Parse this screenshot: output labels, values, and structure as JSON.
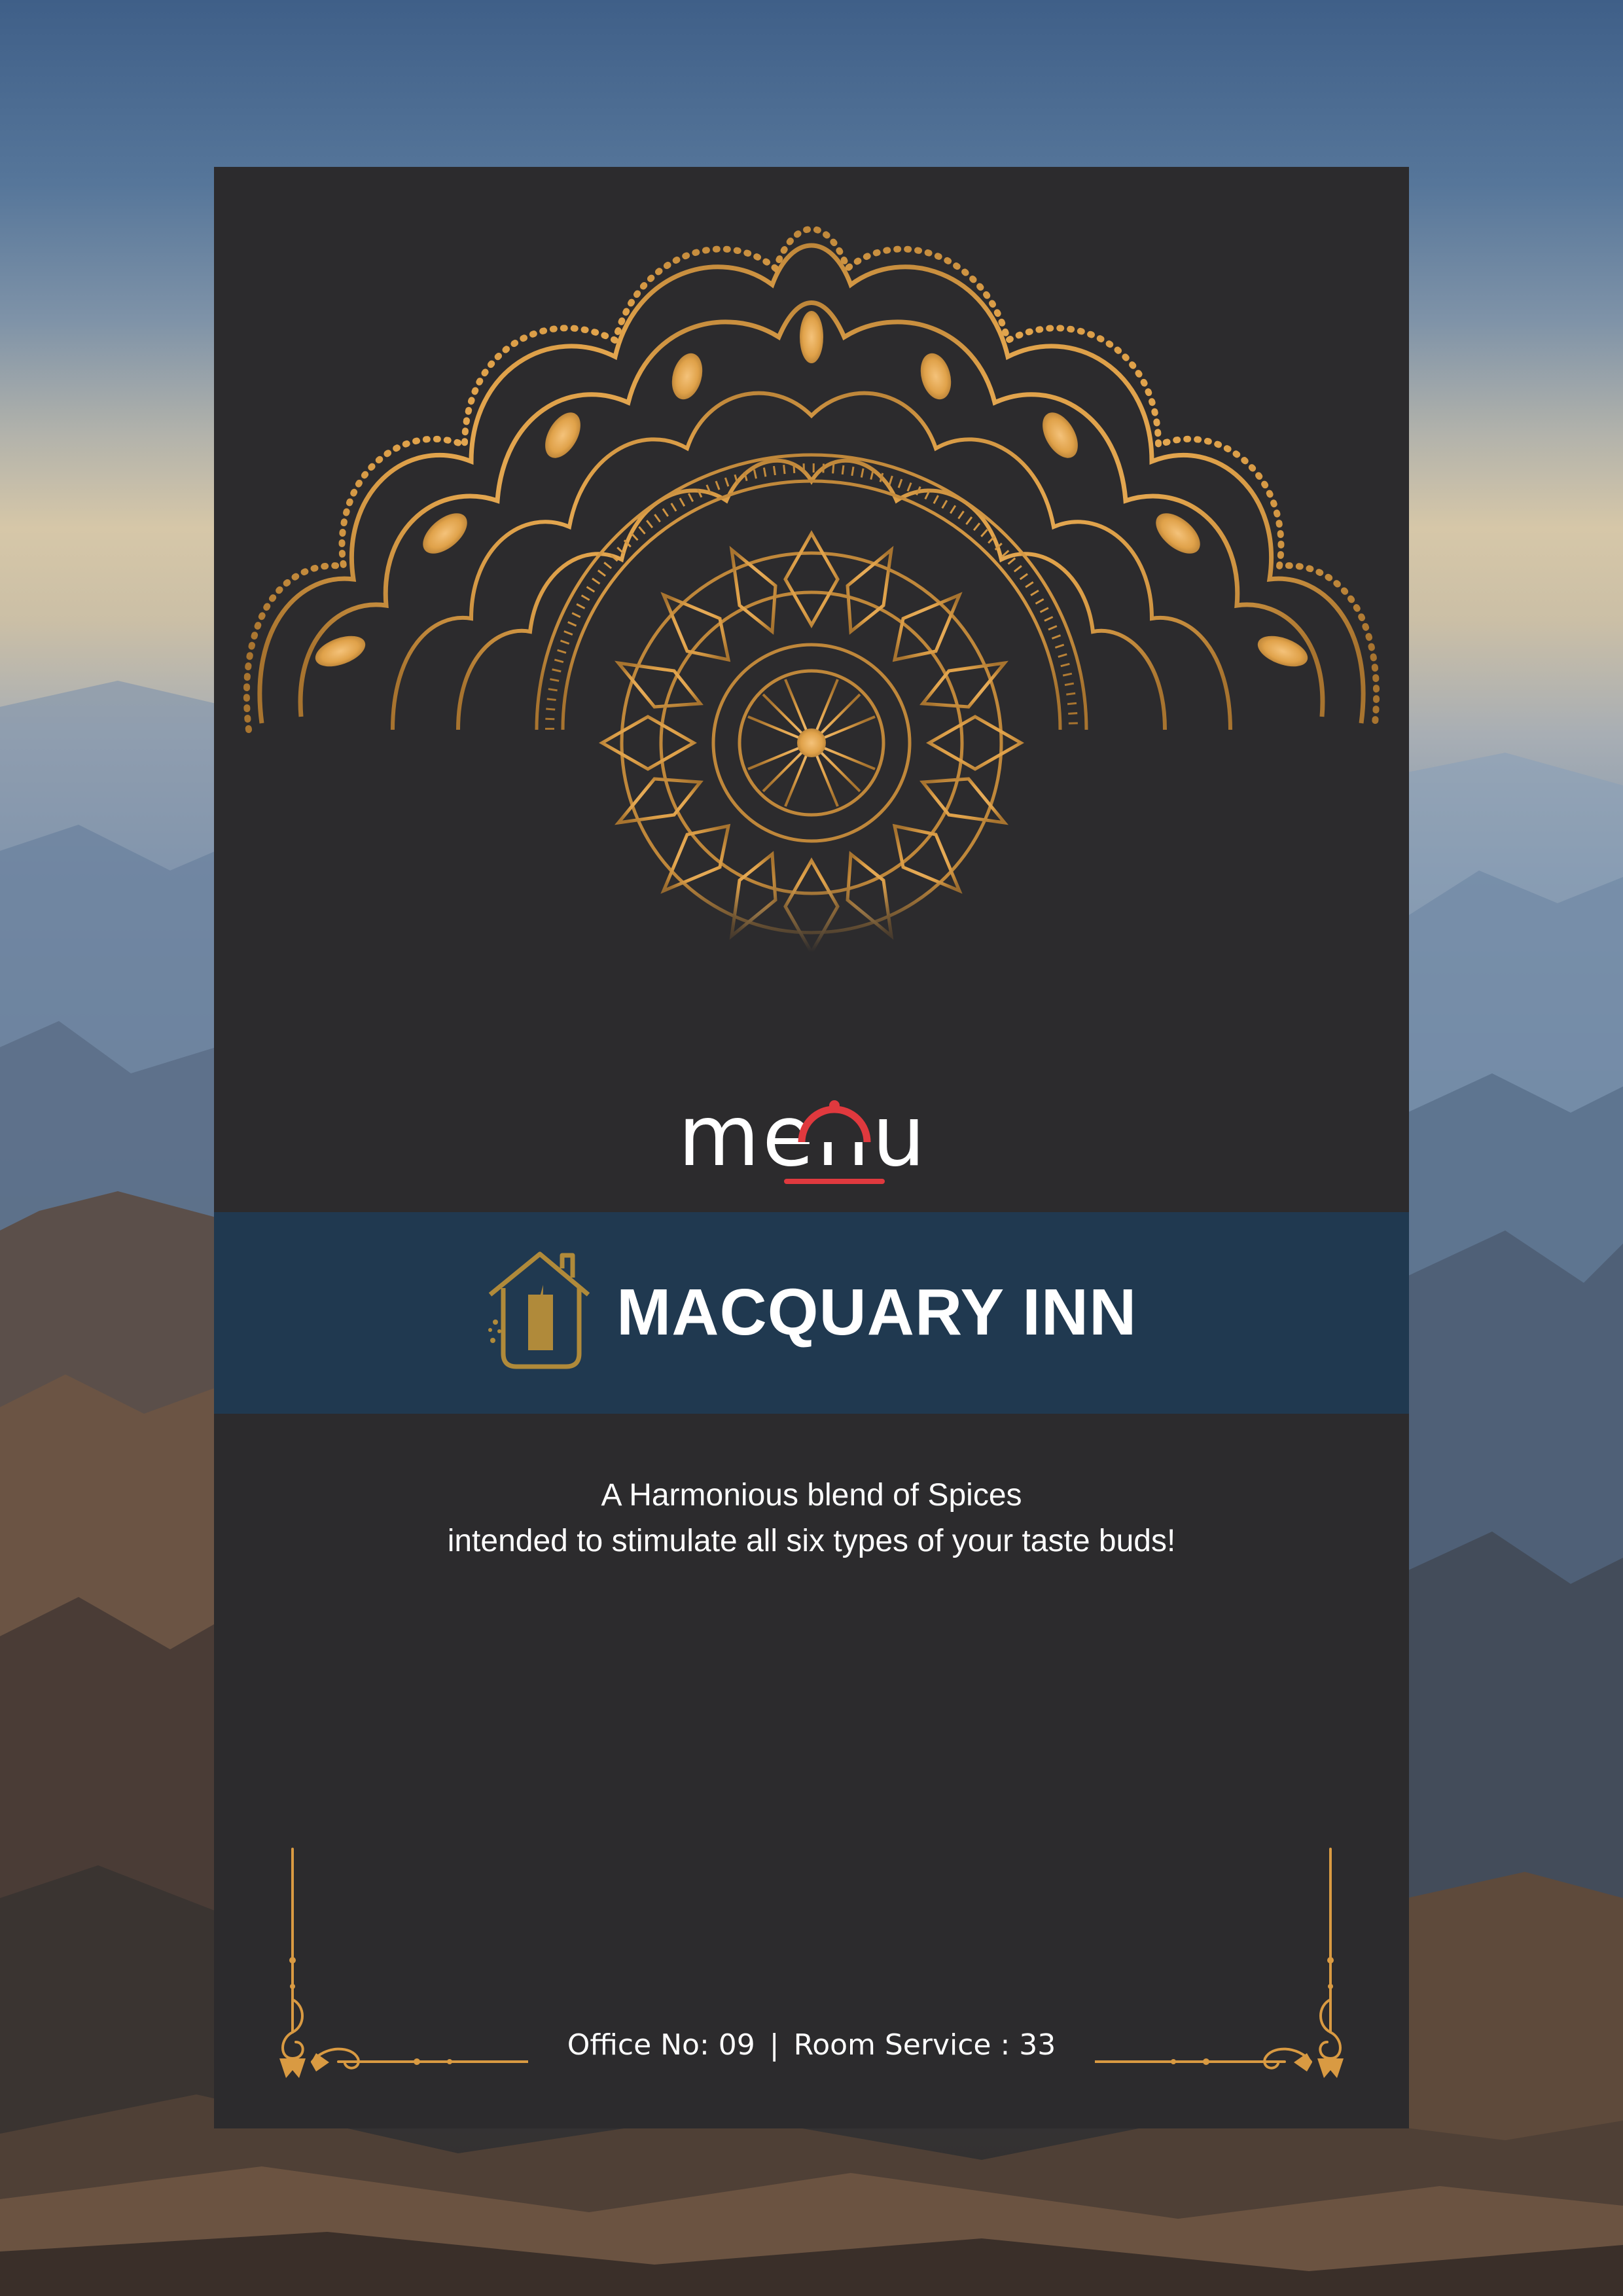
{
  "colors": {
    "card": "#2c2b2d",
    "band": "#203950",
    "gold": "#e0a24a",
    "accent_red": "#e0393e",
    "text": "#ffffff"
  },
  "icons": {
    "mandala": "gold-half-mandala-icon",
    "menu_cloche": "cloche-icon",
    "inn_logo": "house-logo-icon",
    "corner_left": "ornamental-corner-icon",
    "corner_right": "ornamental-corner-icon"
  },
  "logo": {
    "word": "menu"
  },
  "brand": {
    "name": "MACQUARY INN"
  },
  "tagline": {
    "line1": "A Harmonious blend of Spices",
    "line2": "intended to stimulate all six types of your taste buds!"
  },
  "contact": {
    "office": "Office No: 09",
    "separator": "|",
    "room_service": "Room Service : 33"
  }
}
